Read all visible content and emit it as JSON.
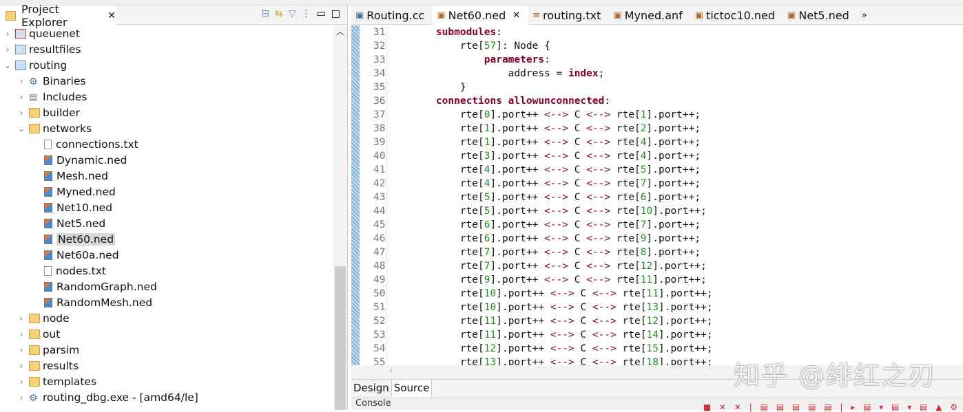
{
  "explorer": {
    "title": "Project Explorer",
    "tree": [
      {
        "label": "queuenet",
        "level": 0,
        "tw": "›",
        "icon": "project-error"
      },
      {
        "label": "resultfiles",
        "level": 0,
        "tw": "›",
        "icon": "project"
      },
      {
        "label": "routing",
        "level": 0,
        "tw": "⌄",
        "icon": "project"
      },
      {
        "label": "Binaries",
        "level": 1,
        "tw": "›",
        "icon": "binaries"
      },
      {
        "label": "Includes",
        "level": 1,
        "tw": "›",
        "icon": "includes"
      },
      {
        "label": "builder",
        "level": 1,
        "tw": "›",
        "icon": "folder"
      },
      {
        "label": "networks",
        "level": 1,
        "tw": "⌄",
        "icon": "folder"
      },
      {
        "label": "connections.txt",
        "level": 2,
        "tw": "",
        "icon": "file"
      },
      {
        "label": "Dynamic.ned",
        "level": 2,
        "tw": "",
        "icon": "ned"
      },
      {
        "label": "Mesh.ned",
        "level": 2,
        "tw": "",
        "icon": "ned"
      },
      {
        "label": "Myned.ned",
        "level": 2,
        "tw": "",
        "icon": "ned"
      },
      {
        "label": "Net10.ned",
        "level": 2,
        "tw": "",
        "icon": "ned"
      },
      {
        "label": "Net5.ned",
        "level": 2,
        "tw": "",
        "icon": "ned"
      },
      {
        "label": "Net60.ned",
        "level": 2,
        "tw": "",
        "icon": "ned",
        "selected": true
      },
      {
        "label": "Net60a.ned",
        "level": 2,
        "tw": "",
        "icon": "ned"
      },
      {
        "label": "nodes.txt",
        "level": 2,
        "tw": "",
        "icon": "file"
      },
      {
        "label": "RandomGraph.ned",
        "level": 2,
        "tw": "",
        "icon": "ned"
      },
      {
        "label": "RandomMesh.ned",
        "level": 2,
        "tw": "",
        "icon": "ned"
      },
      {
        "label": "node",
        "level": 1,
        "tw": "›",
        "icon": "folder"
      },
      {
        "label": "out",
        "level": 1,
        "tw": "›",
        "icon": "folder"
      },
      {
        "label": "parsim",
        "level": 1,
        "tw": "›",
        "icon": "folder"
      },
      {
        "label": "results",
        "level": 1,
        "tw": "›",
        "icon": "folder"
      },
      {
        "label": "templates",
        "level": 1,
        "tw": "›",
        "icon": "folder"
      },
      {
        "label": "routing_dbg.exe - [amd64/le]",
        "level": 1,
        "tw": "›",
        "icon": "binaries"
      }
    ]
  },
  "editor": {
    "tabs": [
      {
        "label": "Routing.cc"
      },
      {
        "label": "Net60.ned",
        "active": true
      },
      {
        "label": "routing.txt"
      },
      {
        "label": "Myned.anf"
      },
      {
        "label": "tictoc10.ned"
      },
      {
        "label": "Net5.ned"
      }
    ],
    "overflow": "»",
    "lines": [
      {
        "n": "31",
        "seg": [
          [
            "    ",
            ""
          ],
          [
            "submodules",
            "kw"
          ],
          [
            ":",
            ""
          ]
        ]
      },
      {
        "n": "32",
        "seg": [
          [
            "        rte[",
            ""
          ],
          [
            "57",
            "nm"
          ],
          [
            "]: Node {",
            ""
          ]
        ]
      },
      {
        "n": "33",
        "seg": [
          [
            "            ",
            ""
          ],
          [
            "parameters",
            "kw"
          ],
          [
            ":",
            ""
          ]
        ]
      },
      {
        "n": "34",
        "seg": [
          [
            "                address = ",
            ""
          ],
          [
            "index",
            "kw"
          ],
          [
            ";",
            ""
          ]
        ]
      },
      {
        "n": "35",
        "seg": [
          [
            "        }",
            ""
          ]
        ]
      },
      {
        "n": "36",
        "seg": [
          [
            "    ",
            ""
          ],
          [
            "connections allowunconnected",
            "kw"
          ],
          [
            ":",
            ""
          ]
        ]
      }
    ],
    "connections": [
      [
        "37",
        "0",
        "1"
      ],
      [
        "38",
        "1",
        "2"
      ],
      [
        "39",
        "1",
        "4"
      ],
      [
        "40",
        "3",
        "4"
      ],
      [
        "41",
        "4",
        "5"
      ],
      [
        "42",
        "4",
        "7"
      ],
      [
        "43",
        "5",
        "6"
      ],
      [
        "44",
        "5",
        "10"
      ],
      [
        "45",
        "6",
        "7"
      ],
      [
        "46",
        "6",
        "9"
      ],
      [
        "47",
        "7",
        "8"
      ],
      [
        "48",
        "7",
        "12"
      ],
      [
        "49",
        "9",
        "11"
      ],
      [
        "50",
        "10",
        "11"
      ],
      [
        "51",
        "10",
        "13"
      ],
      [
        "52",
        "11",
        "12"
      ],
      [
        "53",
        "11",
        "14"
      ],
      [
        "54",
        "12",
        "15"
      ],
      [
        "55",
        "13",
        "18"
      ]
    ],
    "bottom_tabs": [
      "Design",
      "Source"
    ]
  },
  "console": {
    "label": "Console"
  },
  "watermark": "知乎 @绯红之刃"
}
